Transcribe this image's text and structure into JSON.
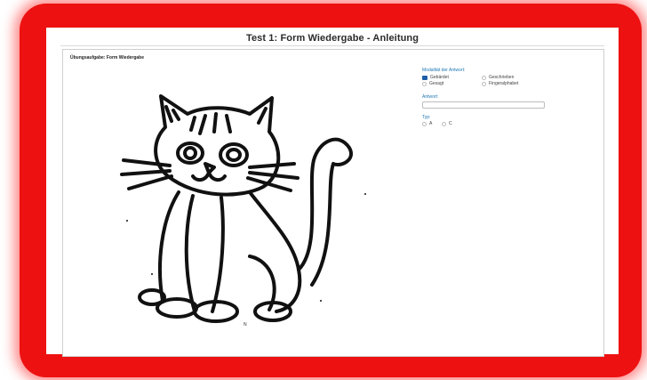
{
  "page": {
    "title": "Test 1: Form Wiedergabe - Anleitung",
    "task_label": "Übungsaufgabe: Form Wiedergabe",
    "image_caption": "N"
  },
  "form": {
    "modality_label": "Modalität der Antwort:",
    "modality_options": [
      {
        "label": "Gebärdet",
        "checked": true
      },
      {
        "label": "Geschrieben",
        "checked": false
      },
      {
        "label": "Gesagt",
        "checked": false
      },
      {
        "label": "Fingeralphabet",
        "checked": false
      }
    ],
    "answer_label": "Antwort:",
    "answer_value": "",
    "type_label": "Typ:",
    "type_options": [
      {
        "label": "A",
        "checked": false
      },
      {
        "label": "C",
        "checked": false
      }
    ]
  },
  "colors": {
    "frame": "#ee1111",
    "accent": "#1f78b4",
    "checked": "#1f5ea8"
  },
  "icons": {
    "stimulus": "cat-drawing"
  }
}
